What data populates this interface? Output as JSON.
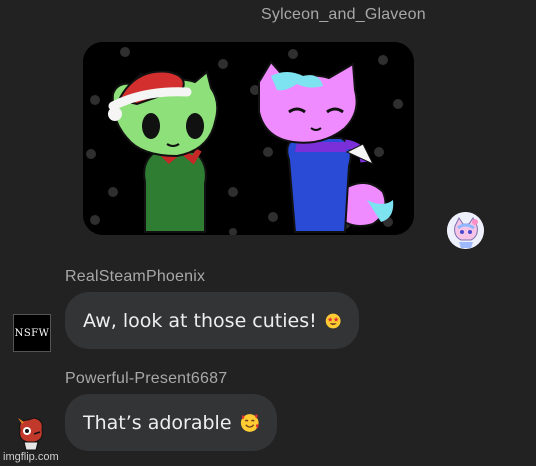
{
  "messages": [
    {
      "username": "Sylceon_and_Glaveon",
      "type": "image",
      "avatar_icon": "sylveon-glaceon-avatar-icon"
    },
    {
      "username": "RealSteamPhoenix",
      "text": "Aw, look at those cuties!",
      "emoji": "star-struck-emoji-icon",
      "avatar_label": "NSFW"
    },
    {
      "username": "Powerful-Present6687",
      "text": "That’s adorable",
      "emoji": "smiling-face-with-hearts-emoji-icon",
      "avatar_icon": "character-avatar-icon"
    }
  ],
  "watermark": "imgflip.com",
  "colors": {
    "background": "#222223",
    "bubble": "#333436",
    "username": "#a8a8a8",
    "text": "#eeeeee"
  }
}
